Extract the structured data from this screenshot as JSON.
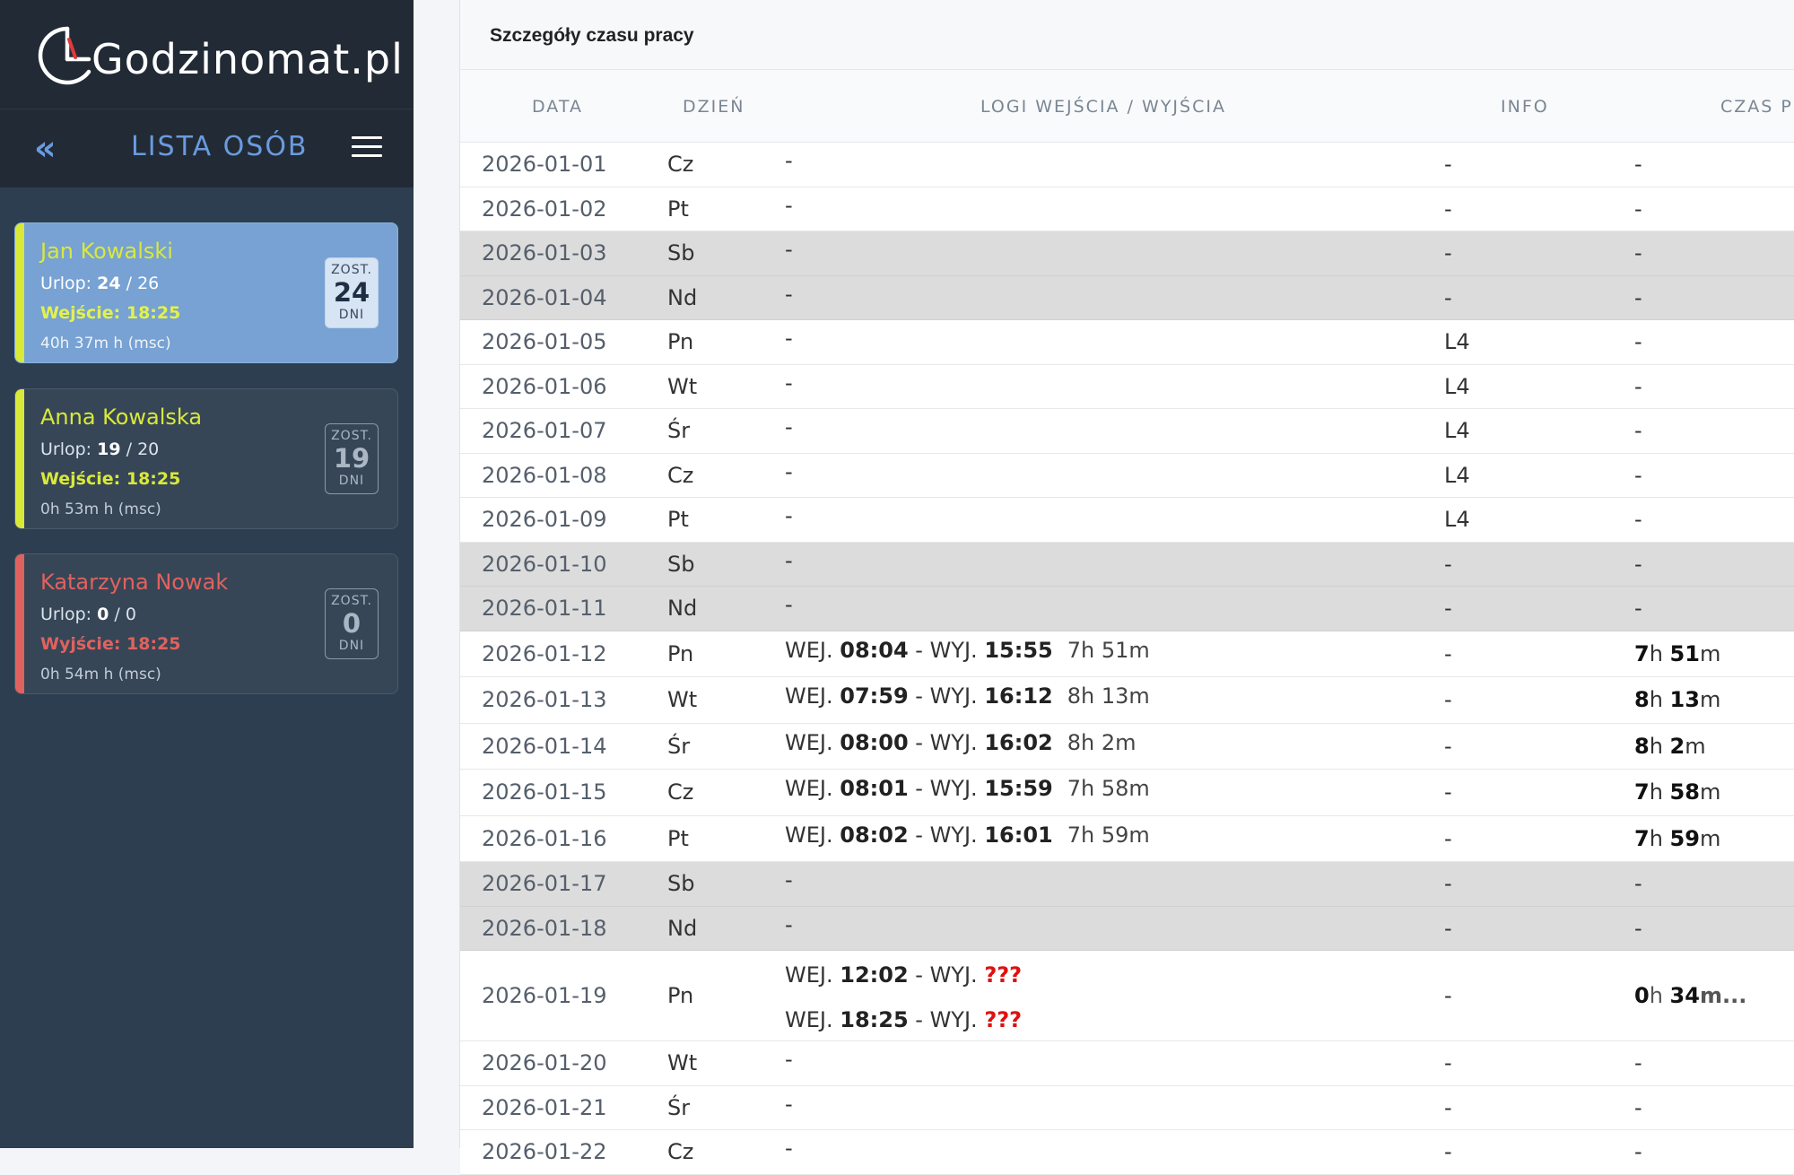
{
  "logo": {
    "text": "Godzinomat.pl"
  },
  "sidebar": {
    "collapse_icon": "«",
    "title": "LISTA OSÓB",
    "people": [
      {
        "name": "Jan Kowalski",
        "urlop_label": "Urlop:",
        "urlop_used": "24",
        "urlop_total": "/ 26",
        "event": "Wejście: 18:25",
        "hours": "40h 37m h (msc)",
        "badge_top": "ZOST.",
        "badge_num": "24",
        "badge_bot": "DNI",
        "accent": "#d9e93a",
        "event_color": "#e3f24a",
        "active": true
      },
      {
        "name": "Anna Kowalska",
        "urlop_label": "Urlop:",
        "urlop_used": "19",
        "urlop_total": "/ 20",
        "event": "Wejście: 18:25",
        "hours": "0h 53m h (msc)",
        "badge_top": "ZOST.",
        "badge_num": "19",
        "badge_bot": "DNI",
        "accent": "#d9e93a",
        "event_color": "#d9e93a",
        "active": false
      },
      {
        "name": "Katarzyna Nowak",
        "urlop_label": "Urlop:",
        "urlop_used": "0",
        "urlop_total": "/ 0",
        "event": "Wyjście: 18:25",
        "hours": "0h 54m h (msc)",
        "badge_top": "ZOST.",
        "badge_num": "0",
        "badge_bot": "DNI",
        "accent": "#e0625e",
        "event_color": "#e0625e",
        "active": false
      }
    ]
  },
  "panel": {
    "title": "Szczegóły czasu pracy",
    "columns": {
      "date": "DATA",
      "day": "DZIEŃ",
      "logs": "LOGI WEJŚCIA / WYJŚCIA",
      "info": "INFO",
      "time": "CZAS PR"
    }
  },
  "labels": {
    "in": "WEJ.",
    "out": "WYJ.",
    "sep": " - ",
    "unknown": "???"
  },
  "rows": [
    {
      "date": "2026-01-01",
      "day": "Cz",
      "logs": [],
      "info": "-",
      "time": "-",
      "weekend": false
    },
    {
      "date": "2026-01-02",
      "day": "Pt",
      "logs": [],
      "info": "-",
      "time": "-",
      "weekend": false
    },
    {
      "date": "2026-01-03",
      "day": "Sb",
      "logs": [],
      "info": "-",
      "time": "-",
      "weekend": true
    },
    {
      "date": "2026-01-04",
      "day": "Nd",
      "logs": [],
      "info": "-",
      "time": "-",
      "weekend": true
    },
    {
      "date": "2026-01-05",
      "day": "Pn",
      "logs": [],
      "info": "L4",
      "time": "-",
      "weekend": false
    },
    {
      "date": "2026-01-06",
      "day": "Wt",
      "logs": [],
      "info": "L4",
      "time": "-",
      "weekend": false
    },
    {
      "date": "2026-01-07",
      "day": "Śr",
      "logs": [],
      "info": "L4",
      "time": "-",
      "weekend": false
    },
    {
      "date": "2026-01-08",
      "day": "Cz",
      "logs": [],
      "info": "L4",
      "time": "-",
      "weekend": false
    },
    {
      "date": "2026-01-09",
      "day": "Pt",
      "logs": [],
      "info": "L4",
      "time": "-",
      "weekend": false
    },
    {
      "date": "2026-01-10",
      "day": "Sb",
      "logs": [],
      "info": "-",
      "time": "-",
      "weekend": true
    },
    {
      "date": "2026-01-11",
      "day": "Nd",
      "logs": [],
      "info": "-",
      "time": "-",
      "weekend": true
    },
    {
      "date": "2026-01-12",
      "day": "Pn",
      "logs": [
        {
          "in": "08:04",
          "out": "15:55",
          "dur": "7h 51m"
        }
      ],
      "info": "-",
      "time_h": "7",
      "time_m": "51",
      "weekend": false
    },
    {
      "date": "2026-01-13",
      "day": "Wt",
      "logs": [
        {
          "in": "07:59",
          "out": "16:12",
          "dur": "8h 13m"
        }
      ],
      "info": "-",
      "time_h": "8",
      "time_m": "13",
      "weekend": false
    },
    {
      "date": "2026-01-14",
      "day": "Śr",
      "logs": [
        {
          "in": "08:00",
          "out": "16:02",
          "dur": "8h 2m"
        }
      ],
      "info": "-",
      "time_h": "8",
      "time_m": "2",
      "weekend": false
    },
    {
      "date": "2026-01-15",
      "day": "Cz",
      "logs": [
        {
          "in": "08:01",
          "out": "15:59",
          "dur": "7h 58m"
        }
      ],
      "info": "-",
      "time_h": "7",
      "time_m": "58",
      "weekend": false
    },
    {
      "date": "2026-01-16",
      "day": "Pt",
      "logs": [
        {
          "in": "08:02",
          "out": "16:01",
          "dur": "7h 59m"
        }
      ],
      "info": "-",
      "time_h": "7",
      "time_m": "59",
      "weekend": false
    },
    {
      "date": "2026-01-17",
      "day": "Sb",
      "logs": [],
      "info": "-",
      "time": "-",
      "weekend": true
    },
    {
      "date": "2026-01-18",
      "day": "Nd",
      "logs": [],
      "info": "-",
      "time": "-",
      "weekend": true
    },
    {
      "date": "2026-01-19",
      "day": "Pn",
      "logs": [
        {
          "in": "12:02",
          "out": null
        },
        {
          "in": "18:25",
          "out": null
        }
      ],
      "info": "-",
      "time_h": "0",
      "time_m": "34",
      "time_suffix": "m...",
      "weekend": false
    },
    {
      "date": "2026-01-20",
      "day": "Wt",
      "logs": [],
      "info": "-",
      "time": "-",
      "weekend": false
    },
    {
      "date": "2026-01-21",
      "day": "Śr",
      "logs": [],
      "info": "-",
      "time": "-",
      "weekend": false
    },
    {
      "date": "2026-01-22",
      "day": "Cz",
      "logs": [],
      "info": "-",
      "time": "-",
      "weekend": false
    }
  ]
}
